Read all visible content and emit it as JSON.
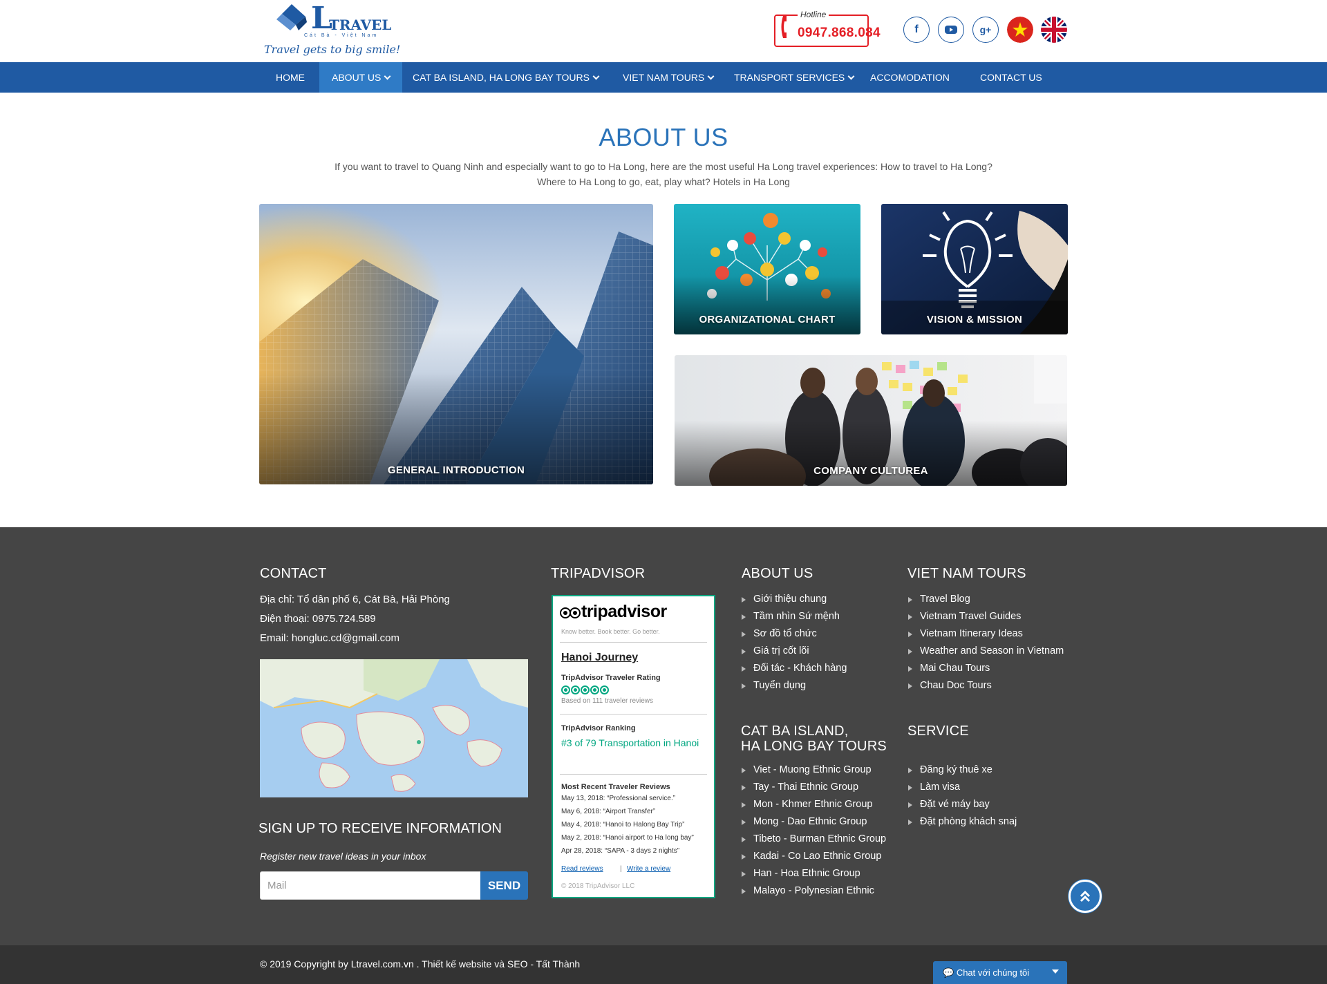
{
  "brand": {
    "logo_letter": "L",
    "logo_word": "TRAVEL",
    "logo_sub": "Cát Bà - Việt Nam",
    "slogan": "Travel gets to big smile!"
  },
  "hotline": {
    "label": "Hotline",
    "number": "0947.868.084"
  },
  "social": [
    {
      "name": "facebook",
      "glyph": "f"
    },
    {
      "name": "youtube",
      "glyph": "▶"
    },
    {
      "name": "google-plus",
      "glyph": "g+"
    }
  ],
  "nav": [
    {
      "label": "HOME",
      "dropdown": false,
      "active": false
    },
    {
      "label": "ABOUT US",
      "dropdown": true,
      "active": true
    },
    {
      "label": "CAT BA ISLAND, HA LONG BAY TOURS",
      "dropdown": true,
      "active": false
    },
    {
      "label": "VIET NAM TOURS",
      "dropdown": true,
      "active": false
    },
    {
      "label": "TRANSPORT SERVICES",
      "dropdown": true,
      "active": false
    },
    {
      "label": "ACCOMODATION",
      "dropdown": false,
      "active": false
    },
    {
      "label": "CONTACT US",
      "dropdown": false,
      "active": false
    }
  ],
  "about": {
    "title": "ABOUT US",
    "description": "If you want to travel to Quang Ninh and especially want to go to Ha Long, here are the most useful Ha Long travel experiences: How to travel to Ha Long? Where to Ha Long to go, eat, play what? Hotels in Ha Long",
    "tiles": {
      "general": "GENERAL INTRODUCTION",
      "org_chart": "ORGANIZATIONAL CHART",
      "vision": "VISION & MISSION",
      "culture": "COMPANY CULTUREA"
    }
  },
  "footer": {
    "contact": {
      "heading": "CONTACT",
      "address": "Địa chỉ: Tổ dân phố 6, Cát Bà, Hải Phòng",
      "phone": "Điện thoại: 0975.724.589",
      "email": "Email: hongluc.cd@gmail.com"
    },
    "signup": {
      "heading": "SIGN UP TO RECEIVE INFORMATION",
      "subtitle": "Register new travel ideas in your inbox",
      "placeholder": "Mail",
      "button": "SEND"
    },
    "tripadvisor": {
      "heading": "TRIPADVISOR",
      "logo": "tripadvisor",
      "tagline": "Know better. Book better. Go better.",
      "business": "Hanoi Journey",
      "rating_label": "TripAdvisor Traveler Rating",
      "rating_bubbles": 5,
      "rating_note": "Based on 111 traveler reviews",
      "ranking_label": "TripAdvisor Ranking",
      "ranking_value": "#3 of 79 Transportation in Hanoi",
      "reviews_label": "Most Recent Traveler Reviews",
      "reviews": [
        "May 13, 2018: “Professional service.”",
        "May 6, 2018: “Airport Transfer”",
        "May 4, 2018: “Hanoi to Halong Bay Trip”",
        "May 2, 2018: “Hanoi airport to Ha long bay”",
        "Apr 28, 2018: “SAPA - 3 days 2 nights”"
      ],
      "read_reviews": "Read reviews",
      "write_review": "Write a review",
      "copyright": "© 2018 TripAdvisor LLC"
    },
    "about_us": {
      "heading": "ABOUT US",
      "items": [
        "Giới thiệu chung",
        "Tầm nhìn Sứ mệnh",
        "Sơ đồ tổ chức",
        "Giá trị cốt lõi",
        "Đối tác - Khách hàng",
        "Tuyển dụng"
      ]
    },
    "cat_ba": {
      "heading_line1": "CAT BA ISLAND,",
      "heading_line2": "HA LONG BAY TOURS",
      "items": [
        "Viet - Muong Ethnic Group",
        "Tay - Thai Ethnic Group",
        "Mon - Khmer Ethnic Group",
        "Mong - Dao Ethnic Group",
        "Tibeto - Burman Ethnic Group",
        "Kadai - Co Lao Ethnic Group",
        "Han - Hoa Ethnic Group",
        "Malayo - Polynesian Ethnic"
      ]
    },
    "viet_nam_tours": {
      "heading": "VIET NAM TOURS",
      "items": [
        "Travel Blog",
        "Vietnam Travel Guides",
        "Vietnam Itinerary Ideas",
        "Weather and Season in Vietnam",
        "Mai Chau Tours",
        "Chau Doc Tours"
      ]
    },
    "service": {
      "heading": "SERVICE",
      "items": [
        "Đăng ký thuê xe",
        "Làm visa",
        "Đặt vé máy bay",
        "Đặt phòng khách snaj"
      ]
    },
    "copyright": "© 2019 Copyright by Ltravel.com.vn . Thiết kế website và SEO - Tất Thành",
    "chat_label": "Chat với chúng tôi"
  },
  "colors": {
    "brand_blue": "#1f5aa3",
    "accent_blue": "#2a73b9",
    "hotline_red": "#e41e25",
    "footer_bg": "#454545",
    "tripadvisor_green": "#00a680"
  }
}
